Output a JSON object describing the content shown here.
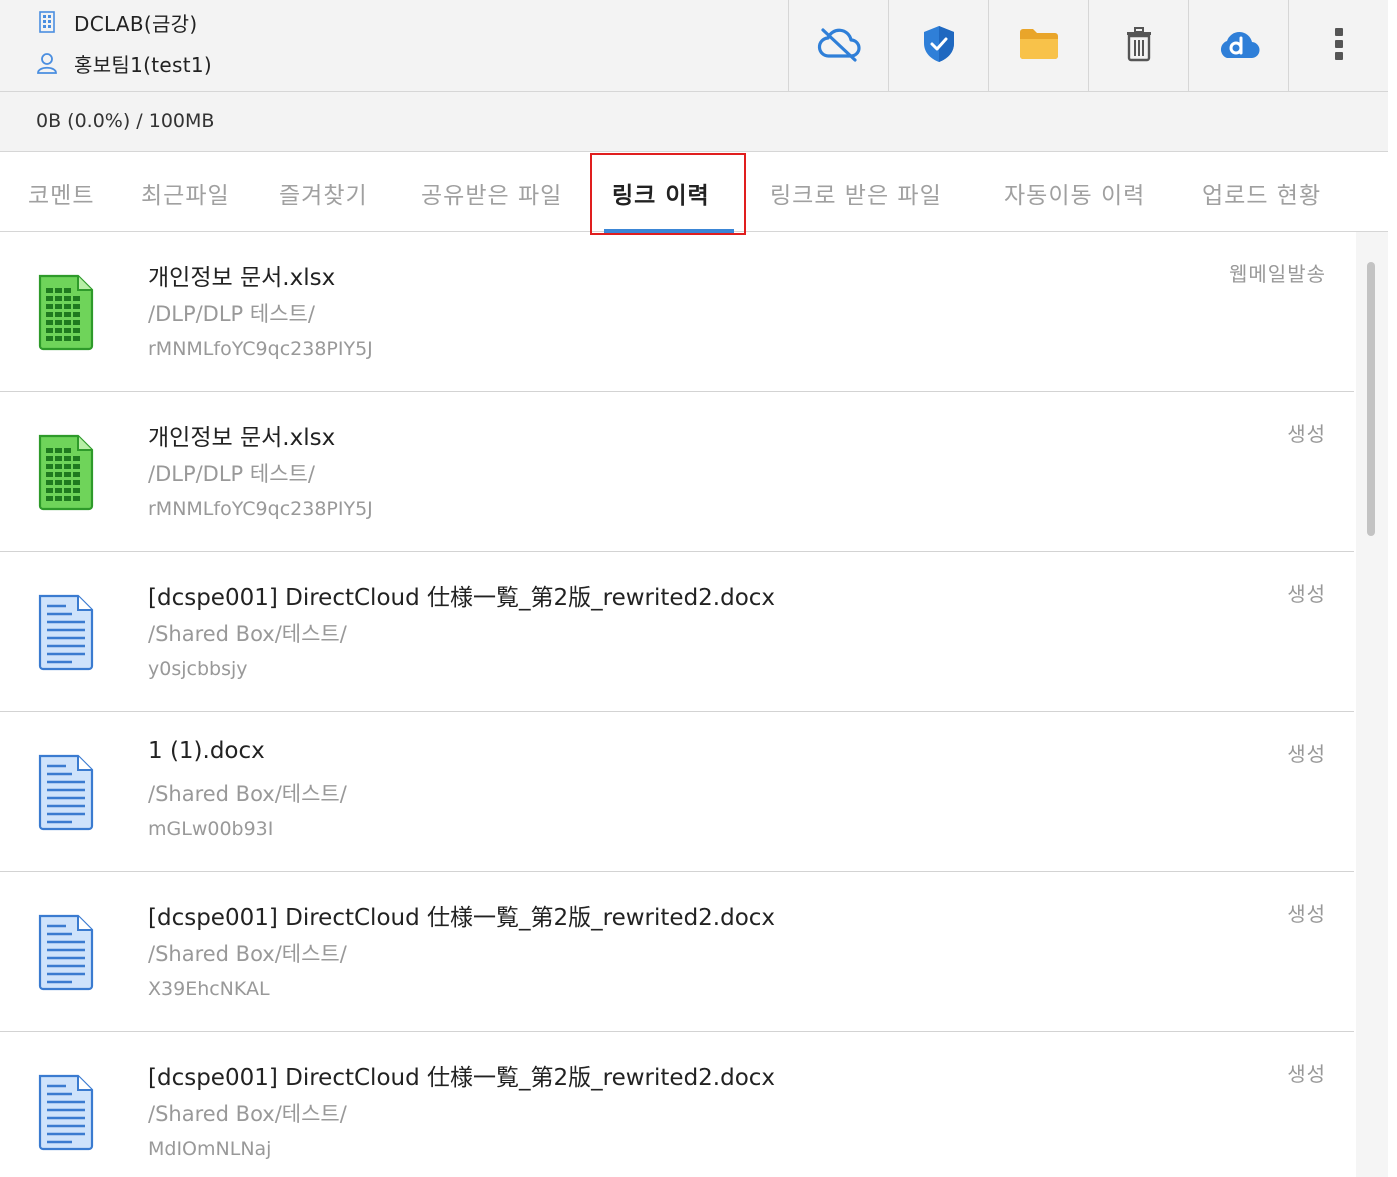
{
  "header": {
    "organization": "DCLAB(금강)",
    "user": "홍보팀1(test1)"
  },
  "toolbar": {
    "buttons": [
      {
        "icon": "cloud-off-icon",
        "color": "#2f7fd8"
      },
      {
        "icon": "shield-check-icon",
        "color": "#2f7fd8"
      },
      {
        "icon": "folder-icon",
        "color": "#f5b93a"
      },
      {
        "icon": "trash-icon",
        "color": "#555555"
      },
      {
        "icon": "directcloud-logo-icon",
        "color": "#2f7fd8"
      },
      {
        "icon": "more-vertical-icon",
        "color": "#555555"
      }
    ]
  },
  "quota": {
    "text": "0B (0.0%) / 100MB"
  },
  "tabs": [
    {
      "label": "코멘트",
      "active": false
    },
    {
      "label": "최근파일",
      "active": false
    },
    {
      "label": "즐겨찾기",
      "active": false
    },
    {
      "label": "공유받은 파일",
      "active": false
    },
    {
      "label": "링크 이력",
      "active": true
    },
    {
      "label": "링크로 받은 파일",
      "active": false
    },
    {
      "label": "자동이동 이력",
      "active": false
    },
    {
      "label": "업로드 현황",
      "active": false
    }
  ],
  "items": [
    {
      "type": "xlsx",
      "name": "개인정보 문서.xlsx",
      "path": "/DLP/DLP 테스트/",
      "code": "rMNMLfoYC9qc238PIY5J",
      "action": "웹메일발송"
    },
    {
      "type": "xlsx",
      "name": "개인정보 문서.xlsx",
      "path": "/DLP/DLP 테스트/",
      "code": "rMNMLfoYC9qc238PIY5J",
      "action": "생성"
    },
    {
      "type": "docx",
      "name": "[dcspe001] DirectCloud 仕様一覧_第2版_rewrited2.docx",
      "path": "/Shared Box/테스트/",
      "code": "y0sjcbbsjy",
      "action": "생성"
    },
    {
      "type": "docx",
      "name": "1 (1).docx",
      "path": "/Shared Box/테스트/",
      "code": "mGLw00b93I",
      "action": "생성"
    },
    {
      "type": "docx",
      "name": "[dcspe001] DirectCloud 仕様一覧_第2版_rewrited2.docx",
      "path": "/Shared Box/테스트/",
      "code": "X39EhcNKAL",
      "action": "생성"
    },
    {
      "type": "docx",
      "name": "[dcspe001] DirectCloud 仕様一覧_第2版_rewrited2.docx",
      "path": "/Shared Box/테스트/",
      "code": "MdIOmNLNaj",
      "action": "생성"
    }
  ]
}
